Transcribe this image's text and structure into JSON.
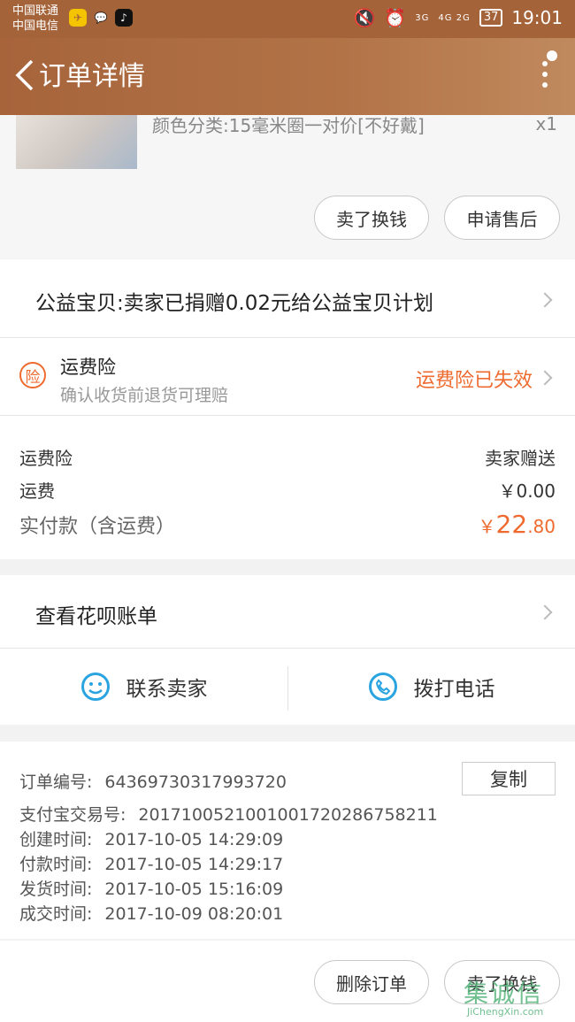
{
  "status_bar": {
    "carrier1": "中国联通",
    "carrier2": "中国电信",
    "net1": "3G",
    "net2": "4G 2G",
    "battery": "37",
    "time": "19:01"
  },
  "header": {
    "title": "订单详情"
  },
  "product": {
    "sku": "颜色分类:15毫米圈一对价[不好戴]",
    "qty": "x1",
    "buttons": [
      "卖了换钱",
      "申请售后"
    ]
  },
  "charity": {
    "text": "公益宝贝:卖家已捐赠0.02元给公益宝贝计划"
  },
  "insurance": {
    "icon_char": "险",
    "title": "运费险",
    "subtitle": "确认收货前退货可理赔",
    "status": "运费险已失效"
  },
  "fees": {
    "rows": [
      {
        "label": "运费险",
        "value": "卖家赠送"
      },
      {
        "label": "运费",
        "value": "￥0.00"
      }
    ],
    "paid_label": "实付款（含运费）",
    "paid_currency": "￥",
    "paid_int": "22",
    "paid_dec": ".80"
  },
  "huabei": {
    "text": "查看花呗账单"
  },
  "contact": {
    "seller": "联系卖家",
    "phone": "拨打电话"
  },
  "order_info": {
    "copy_label": "复制",
    "rows": [
      {
        "label": "订单编号:",
        "value": "64369730317993720"
      },
      {
        "label": "支付宝交易号:",
        "value": "2017100521001001720286758211"
      },
      {
        "label": "创建时间:",
        "value": "2017-10-05 14:29:09"
      },
      {
        "label": "付款时间:",
        "value": "2017-10-05 14:29:17"
      },
      {
        "label": "发货时间:",
        "value": "2017-10-05 15:16:09"
      },
      {
        "label": "成交时间:",
        "value": "2017-10-09 08:20:01"
      }
    ]
  },
  "bottom_bar": {
    "buttons": [
      "删除订单",
      "卖了换钱"
    ]
  },
  "watermark": {
    "cn": "集诚信",
    "en": "JiChengXin.com"
  },
  "colors": {
    "header": "#a5633a",
    "accent": "#ee6a2e",
    "blue": "#2aa4e0"
  }
}
